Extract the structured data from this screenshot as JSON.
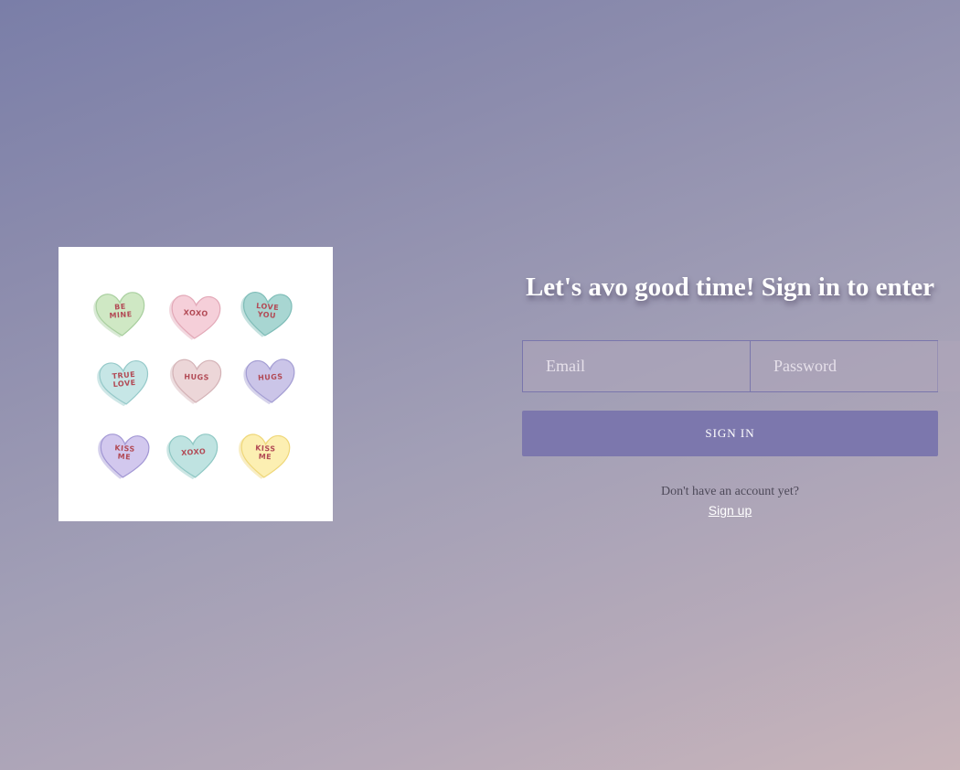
{
  "illustration": {
    "hearts": [
      {
        "text": "BE\nMINE",
        "fill": "#cfe8c4",
        "stroke": "#a9cf9f"
      },
      {
        "text": "XOXO",
        "fill": "#f5cfd9",
        "stroke": "#e3a9b8"
      },
      {
        "text": "LOVE\nYOU",
        "fill": "#a8d6d2",
        "stroke": "#7fbdb8"
      },
      {
        "text": "TRUE\nLOVE",
        "fill": "#c6e6e6",
        "stroke": "#95c9c9"
      },
      {
        "text": "HUGS",
        "fill": "#ecd6d8",
        "stroke": "#d4b3b7"
      },
      {
        "text": "HUGS",
        "fill": "#cbc5e8",
        "stroke": "#a49ed3"
      },
      {
        "text": "KISS\nME",
        "fill": "#d2c8ee",
        "stroke": "#a297d4"
      },
      {
        "text": "XOXO",
        "fill": "#bfe3e1",
        "stroke": "#8fc8c4"
      },
      {
        "text": "KISS\nME",
        "fill": "#fcefb2",
        "stroke": "#efd779"
      }
    ]
  },
  "login": {
    "headline": "Let's avo good time! Sign in to enter",
    "email_placeholder": "Email",
    "password_placeholder": "Password",
    "signin_label": "SIGN IN",
    "account_prompt": "Don't have an account yet?",
    "signup_label": "Sign up"
  },
  "colors": {
    "accent": "#7c77ad",
    "headline_text": "#ffffff",
    "field_border": "#7a76ac"
  }
}
